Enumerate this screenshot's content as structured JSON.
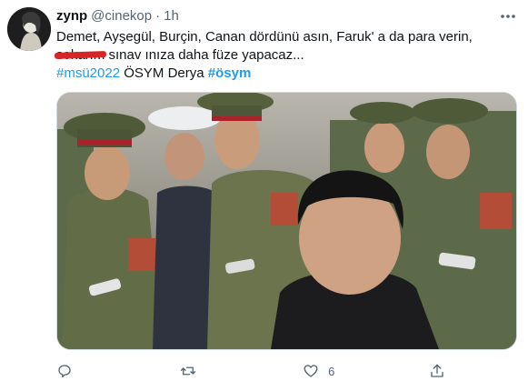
{
  "tweet": {
    "display_name": "zynp",
    "handle": "@cinekop",
    "separator": "·",
    "time": "1h",
    "line1": "Demet, Ayşegül, Burçin, Canan dördünü asın, Faruk' a da para verin,",
    "censored_word": "sokarım",
    "line2_rest": " sınav ınıza daha füze yapacaz...",
    "hashtag1": "#msü2022",
    "plain_text": " ÖSYM Derya ",
    "hashtag2": "#ösym"
  },
  "actions": {
    "reply_count": "",
    "retweet_count": "",
    "like_count": "6",
    "share_count": ""
  },
  "icons": [
    "more-icon",
    "reply-icon",
    "retweet-icon",
    "like-icon",
    "share-icon"
  ],
  "colors": {
    "link": "#1d9bf0",
    "text": "#0f1419",
    "muted": "#536471",
    "censor": "#d62525"
  }
}
